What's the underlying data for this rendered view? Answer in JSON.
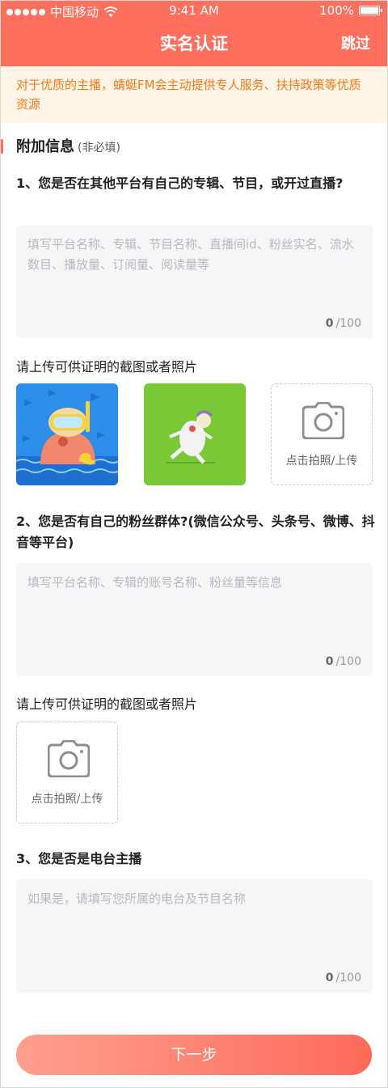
{
  "status_bar": {
    "carrier": "中国移动",
    "time": "9:41 AM",
    "battery": "100%"
  },
  "header": {
    "title": "实名认证",
    "skip_label": "跳过"
  },
  "notice": {
    "text": "对于优质的主播，蜻蜓FM会主动提供专人服务、扶持政策等优质资源"
  },
  "section": {
    "title": "附加信息",
    "subtitle": "(非必填)"
  },
  "q1": {
    "question": "1、您是否在其他平台有自己的专辑、节目，或开过直播?",
    "placeholder": "填写平台名称、专辑、节目名称、直播间id、粉丝实名、流水数目、播放量、订阅量、阅读量等",
    "count_current": "0",
    "count_max": "/100",
    "upload_label": "请上传可供证明的截图或者照片",
    "upload_button": "点击拍照/上传"
  },
  "q2": {
    "question": "2、您是否有自己的粉丝群体?(微信公众号、头条号、微博、抖音等平台)",
    "placeholder": "填写平台名称、专辑的账号名称、粉丝量等信息",
    "count_current": "0",
    "count_max": "/100",
    "upload_label": "请上传可供证明的截图或者照片",
    "upload_button": "点击拍照/上传"
  },
  "q3": {
    "question": "3、您是否是电台主播",
    "placeholder": "如果是，请填写您所属的电台及节目名称",
    "count_current": "0",
    "count_max": "/100"
  },
  "next_button": "下一步",
  "colors": {
    "brand": "#fe6f5e",
    "notice_bg": "#fff4e6",
    "notice_text": "#f27a1a"
  }
}
